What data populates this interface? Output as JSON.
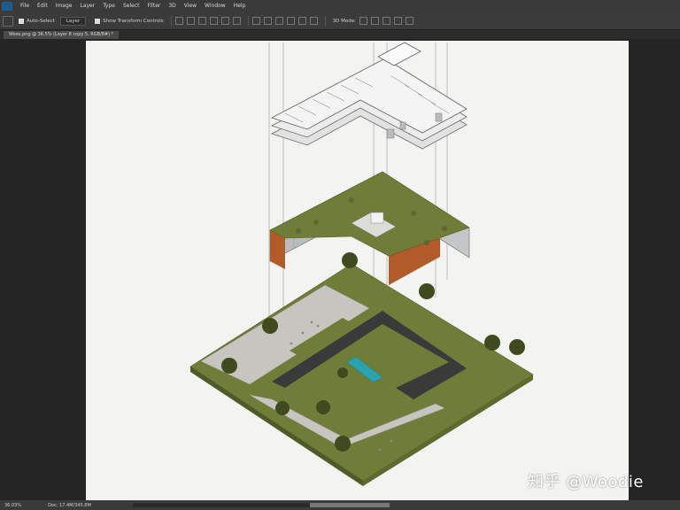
{
  "menu": [
    "File",
    "Edit",
    "Image",
    "Layer",
    "Type",
    "Select",
    "Filter",
    "3D",
    "View",
    "Window",
    "Help"
  ],
  "options_bar": {
    "auto_select_label": "Auto-Select",
    "auto_select_target": "Layer",
    "show_transform_label": "Show Transform Controls",
    "mode_3d_label": "3D Mode:"
  },
  "document_tab": "Woes.png @ 36.5% (Layer 8 copy 5, RGB/8#) *",
  "status": {
    "zoom": "36.03%",
    "doc": "Doc: 17.4M/345.8M"
  },
  "watermark": "知乎 @Woodie",
  "colors": {
    "grass": "#6f7d39",
    "pool": "#2aa3b0",
    "dark_void": "#3a3a3a",
    "cladding": "#b35a2b",
    "plaza": "#c8c5c0"
  }
}
